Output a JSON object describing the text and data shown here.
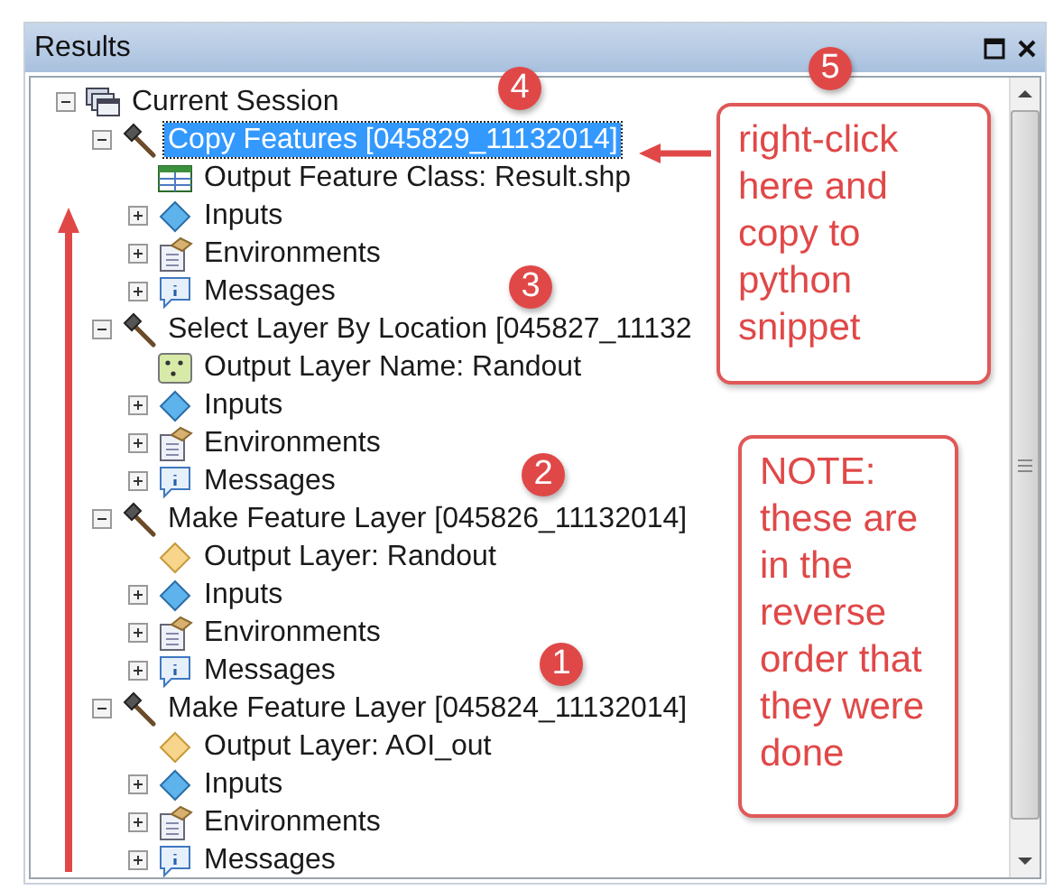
{
  "panel": {
    "title": "Results",
    "buttons": [
      {
        "kind": "maximize"
      },
      {
        "kind": "close"
      }
    ]
  },
  "tree": [
    {
      "label": "Current Session",
      "kind": "session",
      "expanded": true,
      "selected": false,
      "children": [
        {
          "label": "Copy Features [045829_11132014]",
          "kind": "tool",
          "expanded": true,
          "selected": true,
          "children": [
            {
              "label": "Output Feature Class: Result.shp",
              "kind": "table",
              "selected": false
            },
            {
              "label": "Inputs",
              "kind": "inputs",
              "expanded": false,
              "selected": false
            },
            {
              "label": "Environments",
              "kind": "environments",
              "expanded": false,
              "selected": false
            },
            {
              "label": "Messages",
              "kind": "messages",
              "expanded": false,
              "selected": false
            }
          ]
        },
        {
          "label": "Select Layer By Location [045827_11132",
          "kind": "tool",
          "expanded": true,
          "selected": false,
          "children": [
            {
              "label": "Output Layer Name: Randout",
              "kind": "points",
              "selected": false
            },
            {
              "label": "Inputs",
              "kind": "inputs",
              "expanded": false,
              "selected": false
            },
            {
              "label": "Environments",
              "kind": "environments",
              "expanded": false,
              "selected": false
            },
            {
              "label": "Messages",
              "kind": "messages",
              "expanded": false,
              "selected": false
            }
          ]
        },
        {
          "label": "Make Feature Layer [045826_11132014]",
          "kind": "tool",
          "expanded": true,
          "selected": false,
          "children": [
            {
              "label": "Output Layer: Randout",
              "kind": "layer",
              "selected": false
            },
            {
              "label": "Inputs",
              "kind": "inputs",
              "expanded": false,
              "selected": false
            },
            {
              "label": "Environments",
              "kind": "environments",
              "expanded": false,
              "selected": false
            },
            {
              "label": "Messages",
              "kind": "messages",
              "expanded": false,
              "selected": false
            }
          ]
        },
        {
          "label": "Make Feature Layer [045824_11132014]",
          "kind": "tool",
          "expanded": true,
          "selected": false,
          "children": [
            {
              "label": "Output Layer: AOI_out",
              "kind": "layer",
              "selected": false
            },
            {
              "label": "Inputs",
              "kind": "inputs",
              "expanded": false,
              "selected": false
            },
            {
              "label": "Environments",
              "kind": "environments",
              "expanded": false,
              "selected": false
            },
            {
              "label": "Messages",
              "kind": "messages",
              "expanded": false,
              "selected": false
            }
          ]
        }
      ]
    }
  ],
  "annotations": {
    "badges": [
      "4",
      "5",
      "3",
      "2",
      "1"
    ],
    "callouts": [
      "right-click here and copy to python snippet",
      "NOTE: these are in the reverse order that they were done"
    ]
  }
}
